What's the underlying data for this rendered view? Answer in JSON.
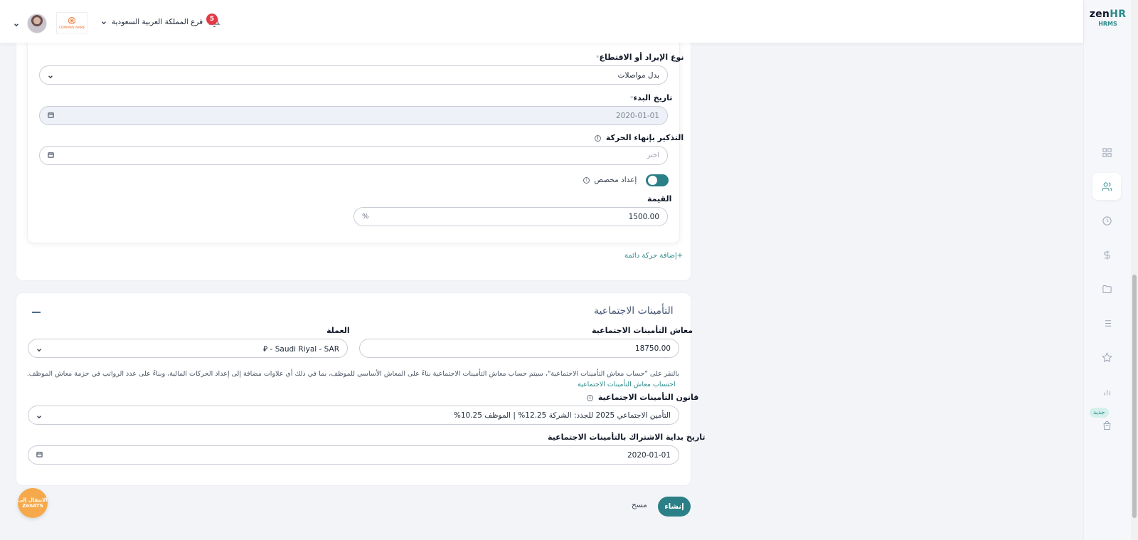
{
  "brand": {
    "logo_main": "zen",
    "logo_accent": "HR",
    "logo_sub": "HRMS"
  },
  "header": {
    "notification_count": "5",
    "branch": "فرع المملكة العربية السعودية",
    "company_logo_text": "COMPANY NAME"
  },
  "sidebar": {
    "items": [
      {
        "icon": "grid-icon"
      },
      {
        "icon": "users-icon",
        "active": true
      },
      {
        "icon": "clock-icon"
      },
      {
        "icon": "dollar-icon"
      },
      {
        "icon": "folder-icon"
      },
      {
        "icon": "list-icon"
      },
      {
        "icon": "star-icon"
      },
      {
        "icon": "bar-chart-icon"
      },
      {
        "icon": "bag-icon"
      }
    ],
    "new_badge": "جديد"
  },
  "transaction": {
    "type_label": "نوع الإيراد أو الاقتطاع",
    "type_value": "بدل مواصلات",
    "start_label": "تاريخ البدء",
    "start_value": "2020-01-01",
    "reminder_label": "التذكير بإنهاء الحركة",
    "reminder_placeholder": "اختر",
    "custom_label": "إعداد مخصص",
    "value_label": "القيمة",
    "value": "1500.00",
    "value_suffix": "%",
    "add_link": "+إضافة حركة دائمة"
  },
  "social": {
    "title": "التأمينات الاجتماعية",
    "salary_label": "معاش التأمينات الاجتماعية",
    "salary_value": "18750.00",
    "currency_label": "العملة",
    "currency_value": "Saudi Riyal - SAR - ⃁",
    "note": "بالنقر على \"حساب معاش التأمينات الاجتماعية\"، سيتم حساب معاش التأمينات الاجتماعية بناءً على المعاش الأساسي للموظف، بما في ذلك أي علاوات مضافة إلى إعداد الحركات المالية، وبناءً على عدد الرواتب في حزمة معاش الموظف.",
    "calc_link": "احتساب  معاش التأمينات الاجتماعية",
    "law_label": "قانون التأمينات الاجتماعية",
    "law_value": "التأمين الاجتماعي 2025 للجدد: الشركة 12.25% | الموظف 10.25%",
    "sub_start_label": "تاريخ بداية الاشتراك بالتأمينات الاجتماعية",
    "sub_start_value": "2020-01-01"
  },
  "actions": {
    "create": "إنشاء",
    "clear": "مسح"
  },
  "zenats": {
    "line1": "الانتقال إلى",
    "line2": "ZenATS"
  },
  "colors": {
    "accent": "#2b8a8a",
    "badge": "#e23a45",
    "zenats": "#f6a94b"
  }
}
